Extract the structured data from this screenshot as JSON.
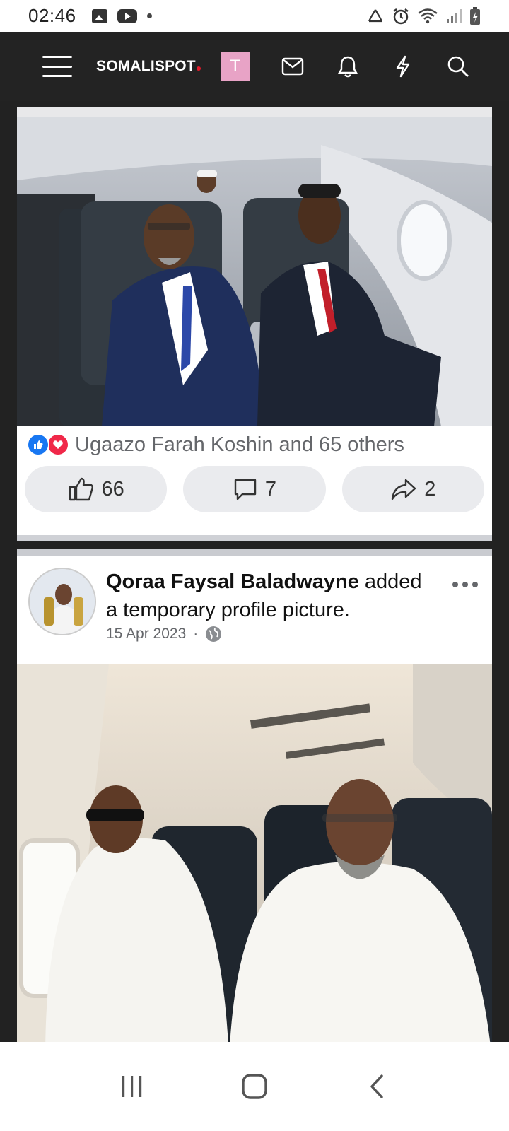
{
  "status_bar": {
    "time": "02:46",
    "icons": [
      "image-icon",
      "youtube-icon",
      "dot-icon",
      "recycle-icon",
      "alarm-icon",
      "wifi-icon",
      "signal-icon",
      "battery-icon"
    ]
  },
  "topnav": {
    "logo": "SOMALISPOT",
    "user_initial": "T",
    "icons": [
      "menu-icon",
      "mail-icon",
      "bell-icon",
      "lightning-icon",
      "search-icon"
    ],
    "accent": "#e31b2b",
    "avatar_color": "#e8a3c6"
  },
  "post1": {
    "reactions_text": "Ugaazo Farah Koshin and 65 others",
    "like_count": "66",
    "comment_count": "7",
    "share_count": "2"
  },
  "post2": {
    "author": "Qoraa Faysal Baladwayne",
    "action": " added a temporary profile picture.",
    "date": "15 Apr 2023",
    "separator": "·",
    "audience_icon": "globe-icon"
  },
  "android_nav": {
    "icons": [
      "recents-icon",
      "home-icon",
      "back-icon"
    ]
  },
  "colors": {
    "like_blue": "#1877f2",
    "love_red": "#f02849",
    "muted_text": "#65676b",
    "button_bg": "#eaebee"
  }
}
